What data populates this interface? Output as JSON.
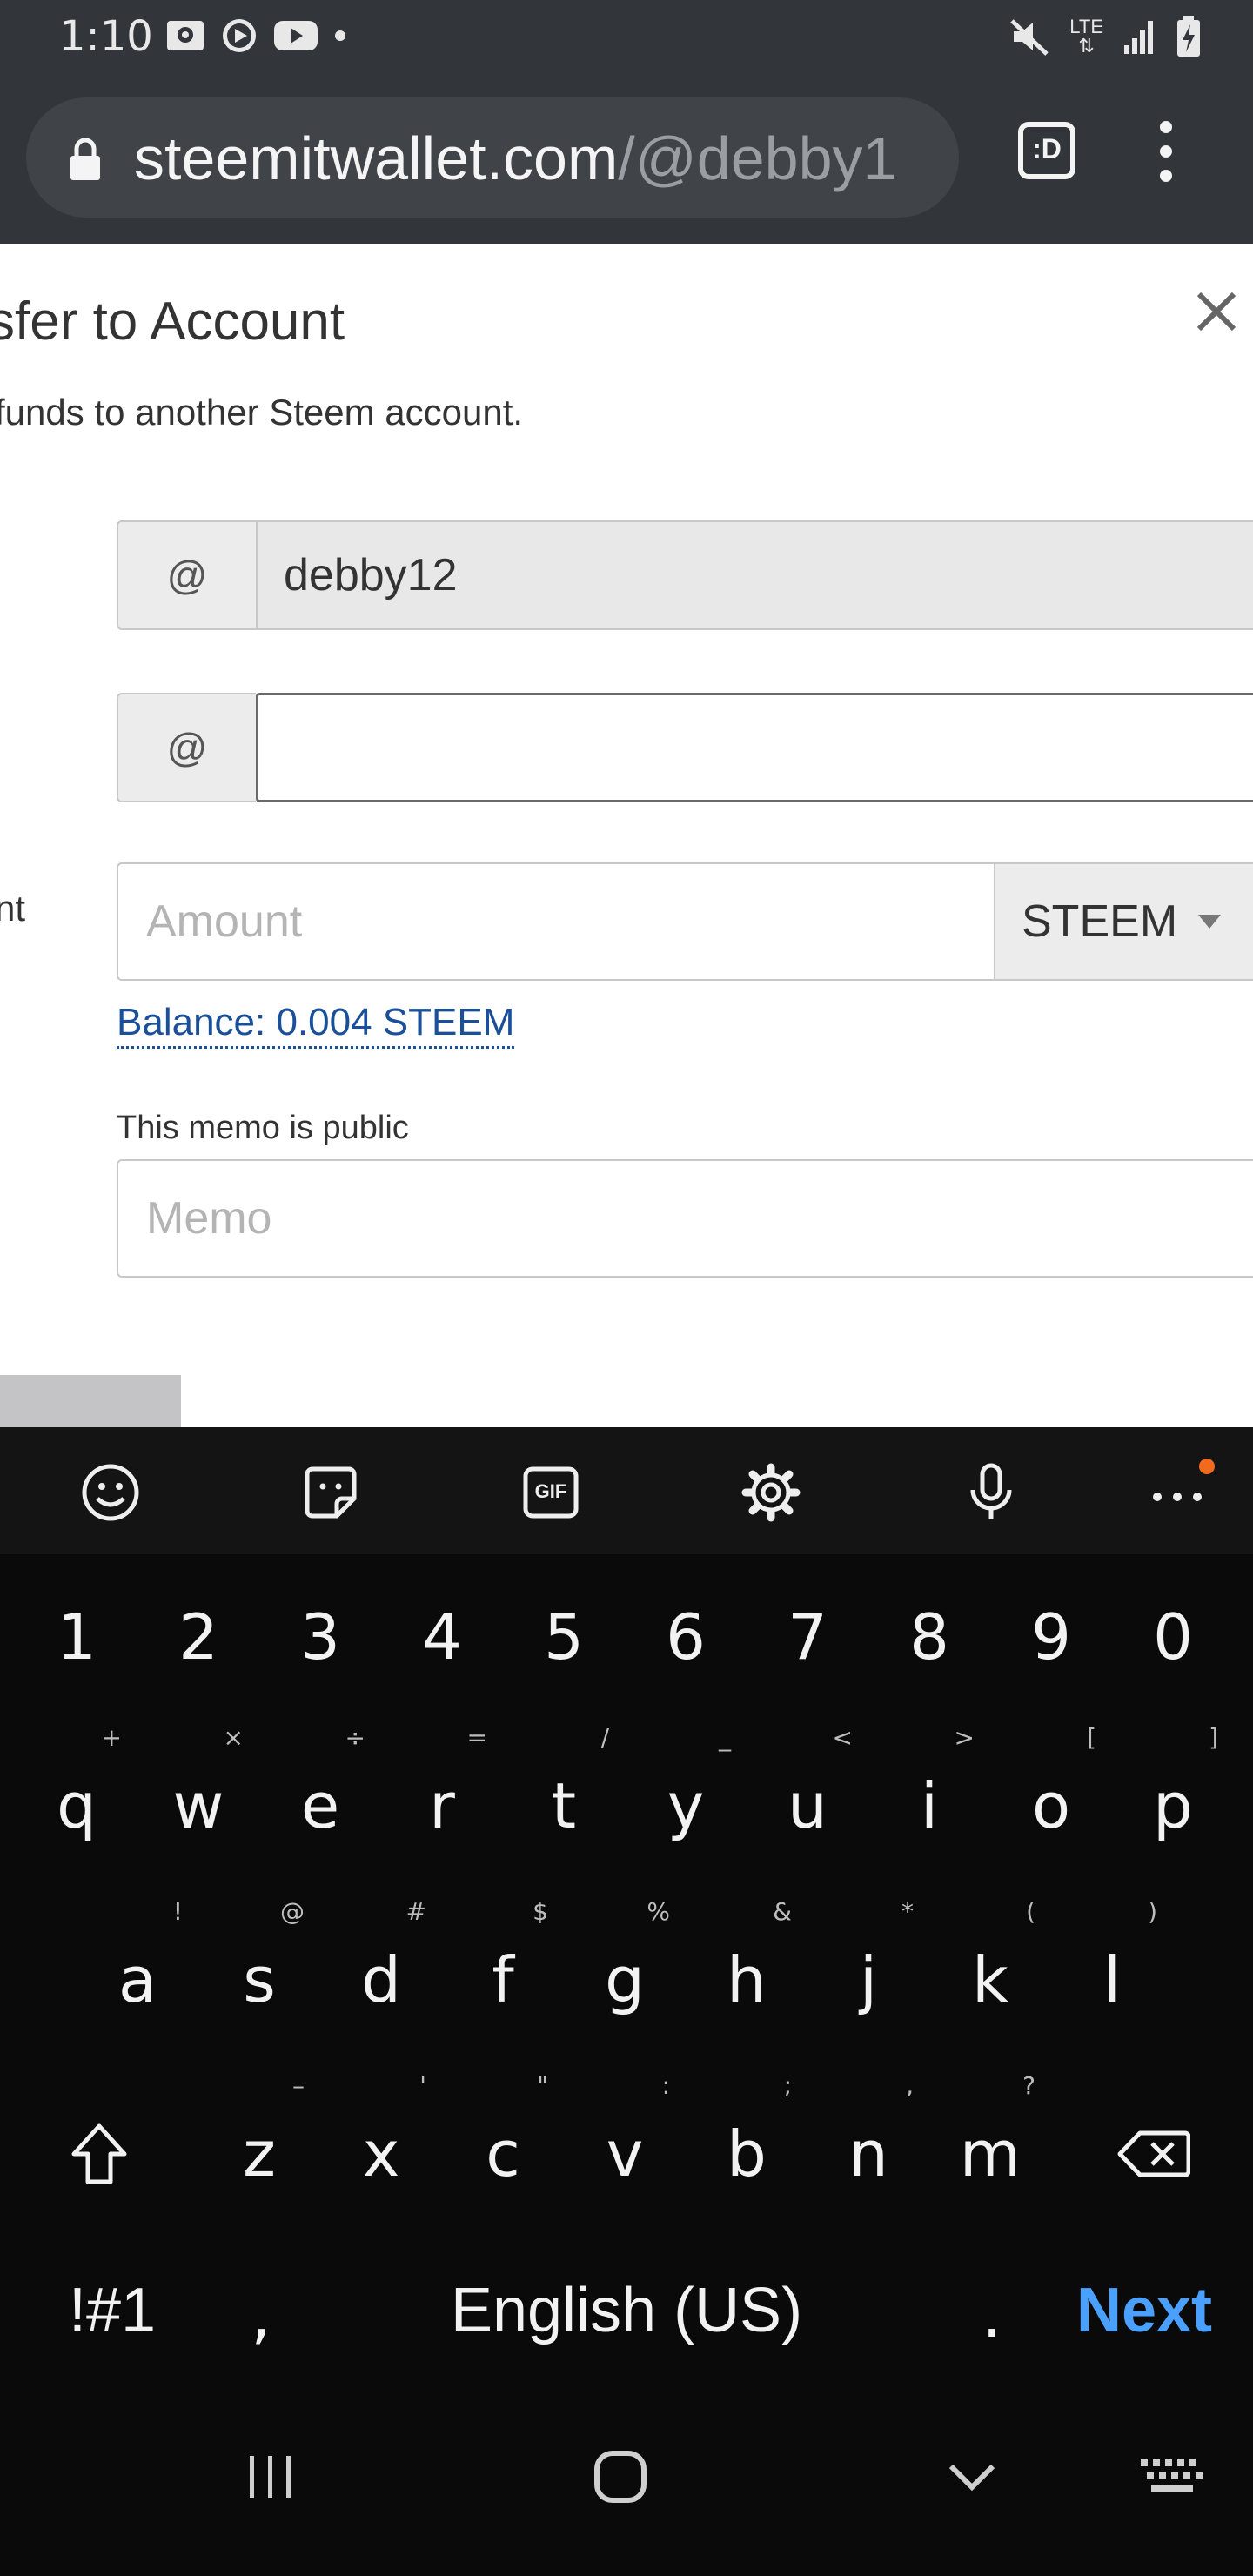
{
  "status_bar": {
    "time": "1:10",
    "network": "LTE",
    "left_icons": [
      "image-notification-icon",
      "play-circle-icon",
      "youtube-icon",
      "dot-icon"
    ],
    "right_icons": [
      "mute-icon",
      "lte-icon",
      "signal-icon",
      "battery-charging-icon"
    ]
  },
  "browser": {
    "url_host": "steemitwallet.com",
    "url_path": "/@debby1",
    "tabs_label": ":D"
  },
  "modal": {
    "title": "sfer to Account",
    "subtitle": "funds to another Steem account.",
    "from_prefix": "@",
    "from_value": "debby12",
    "to_prefix": "@",
    "to_value": "",
    "amount_label": "nt",
    "amount_placeholder": "Amount",
    "asset_selected": "STEEM",
    "balance": "Balance: 0.004 STEEM",
    "memo_note": "This memo is public",
    "memo_placeholder": "Memo"
  },
  "keyboard": {
    "toolbar": [
      "emoji-icon",
      "sticker-icon",
      "gif-icon",
      "settings-icon",
      "microphone-icon",
      "more-icon"
    ],
    "gif_label": "GIF",
    "number_row": [
      "1",
      "2",
      "3",
      "4",
      "5",
      "6",
      "7",
      "8",
      "9",
      "0"
    ],
    "row1": [
      {
        "key": "q",
        "hint": "+"
      },
      {
        "key": "w",
        "hint": "×"
      },
      {
        "key": "e",
        "hint": "÷"
      },
      {
        "key": "r",
        "hint": "="
      },
      {
        "key": "t",
        "hint": "/"
      },
      {
        "key": "y",
        "hint": "_"
      },
      {
        "key": "u",
        "hint": "<"
      },
      {
        "key": "i",
        "hint": ">"
      },
      {
        "key": "o",
        "hint": "["
      },
      {
        "key": "p",
        "hint": "]"
      }
    ],
    "row2": [
      {
        "key": "a",
        "hint": "!"
      },
      {
        "key": "s",
        "hint": "@"
      },
      {
        "key": "d",
        "hint": "#"
      },
      {
        "key": "f",
        "hint": "$"
      },
      {
        "key": "g",
        "hint": "%"
      },
      {
        "key": "h",
        "hint": "&"
      },
      {
        "key": "j",
        "hint": "*"
      },
      {
        "key": "k",
        "hint": "("
      },
      {
        "key": "l",
        "hint": ")"
      }
    ],
    "row3": [
      {
        "key": "z",
        "hint": "–"
      },
      {
        "key": "x",
        "hint": "'"
      },
      {
        "key": "c",
        "hint": "\""
      },
      {
        "key": "v",
        "hint": ":"
      },
      {
        "key": "b",
        "hint": ";"
      },
      {
        "key": "n",
        "hint": ","
      },
      {
        "key": "m",
        "hint": "?"
      }
    ],
    "symbols_label": "!#1",
    "comma": ",",
    "space_label": "English (US)",
    "period": ".",
    "next_label": "Next"
  },
  "nav_bar": [
    "recent-apps-icon",
    "home-icon",
    "back-icon",
    "keyboard-switch-icon"
  ]
}
